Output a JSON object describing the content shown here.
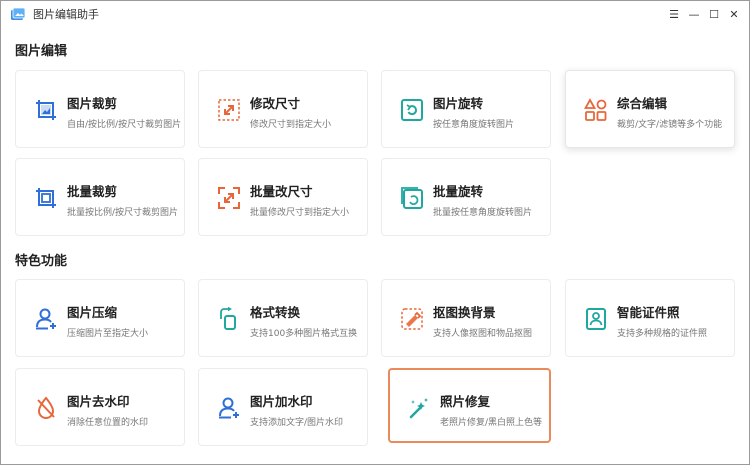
{
  "window": {
    "title": "图片编辑助手",
    "controls": [
      "☰",
      "—",
      "☐",
      "✕"
    ]
  },
  "sections": [
    {
      "title": "图片编辑",
      "cards": [
        {
          "title": "图片裁剪",
          "desc": "自由/按比例/按尺寸裁剪图片",
          "icon": "crop-icon"
        },
        {
          "title": "修改尺寸",
          "desc": "修改尺寸到指定大小",
          "icon": "resize-icon"
        },
        {
          "title": "图片旋转",
          "desc": "按任意角度旋转图片",
          "icon": "rotate-icon"
        },
        {
          "title": "综合编辑",
          "desc": "裁剪/文字/滤镜等多个功能",
          "icon": "shapes-icon"
        },
        {
          "title": "批量裁剪",
          "desc": "批量按比例/按尺寸裁剪图片",
          "icon": "batch-crop-icon"
        },
        {
          "title": "批量改尺寸",
          "desc": "批量修改尺寸到指定大小",
          "icon": "batch-resize-icon"
        },
        {
          "title": "批量旋转",
          "desc": "批量按任意角度旋转图片",
          "icon": "batch-rotate-icon"
        }
      ]
    },
    {
      "title": "特色功能",
      "cards": [
        {
          "title": "图片压缩",
          "desc": "压缩图片至指定大小",
          "icon": "compress-icon"
        },
        {
          "title": "格式转换",
          "desc": "支持100多种图片格式互换",
          "icon": "format-convert-icon"
        },
        {
          "title": "抠图换背景",
          "desc": "支持人像抠图和物品抠图",
          "icon": "cutout-icon"
        },
        {
          "title": "智能证件照",
          "desc": "支持多种规格的证件照",
          "icon": "id-photo-icon"
        },
        {
          "title": "图片去水印",
          "desc": "消除任意位置的水印",
          "icon": "remove-watermark-icon"
        },
        {
          "title": "图片加水印",
          "desc": "支持添加文字/图片水印",
          "icon": "add-watermark-icon"
        },
        {
          "title": "照片修复",
          "desc": "老照片修复/黑白照上色等",
          "icon": "magic-wand-icon"
        }
      ]
    }
  ],
  "colors": {
    "blue": "#2f6fd8",
    "orange": "#e8673a",
    "teal": "#1fa7a0",
    "selected_border": "#e98a5a"
  }
}
